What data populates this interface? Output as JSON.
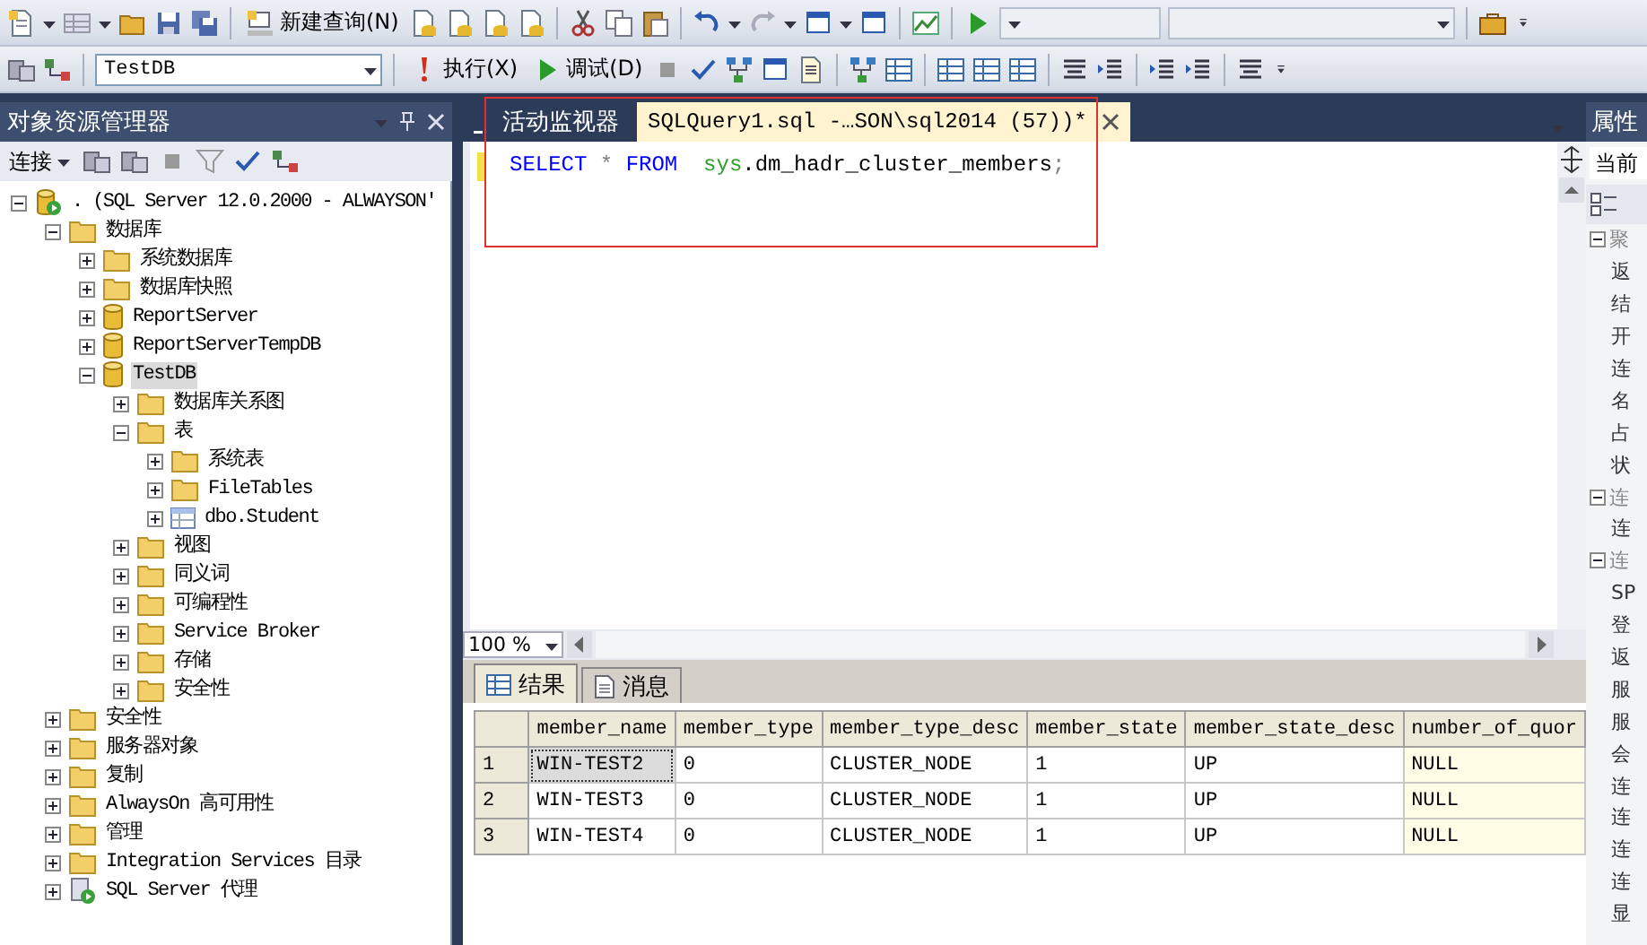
{
  "toolbar": {
    "new_query": "新建查询(N)",
    "database": "TestDB",
    "execute": "执行(X)",
    "debug": "调试(D)"
  },
  "object_explorer": {
    "title": "对象资源管理器",
    "connect": "连接",
    "tree": [
      {
        "label": ". (SQL Server 12.0.2000 - ALWAYSON'",
        "kind": "server",
        "expanded": true,
        "selected": false,
        "children": [
          {
            "label": "数据库",
            "kind": "folder",
            "expanded": true,
            "selected": false,
            "children": [
              {
                "label": "系统数据库",
                "kind": "folder",
                "expanded": false,
                "selected": false
              },
              {
                "label": "数据库快照",
                "kind": "folder",
                "expanded": false,
                "selected": false
              },
              {
                "label": "ReportServer",
                "kind": "database",
                "expanded": false,
                "selected": false
              },
              {
                "label": "ReportServerTempDB",
                "kind": "database",
                "expanded": false,
                "selected": false
              },
              {
                "label": "TestDB",
                "kind": "database",
                "expanded": true,
                "selected": true,
                "children": [
                  {
                    "label": "数据库关系图",
                    "kind": "folder",
                    "expanded": false,
                    "selected": false
                  },
                  {
                    "label": "表",
                    "kind": "folder",
                    "expanded": true,
                    "selected": false,
                    "children": [
                      {
                        "label": "系统表",
                        "kind": "folder",
                        "expanded": false,
                        "selected": false
                      },
                      {
                        "label": "FileTables",
                        "kind": "folder",
                        "expanded": false,
                        "selected": false
                      },
                      {
                        "label": "dbo.Student",
                        "kind": "table",
                        "expanded": false,
                        "selected": false
                      }
                    ]
                  },
                  {
                    "label": "视图",
                    "kind": "folder",
                    "expanded": false,
                    "selected": false
                  },
                  {
                    "label": "同义词",
                    "kind": "folder",
                    "expanded": false,
                    "selected": false
                  },
                  {
                    "label": "可编程性",
                    "kind": "folder",
                    "expanded": false,
                    "selected": false
                  },
                  {
                    "label": "Service Broker",
                    "kind": "folder",
                    "expanded": false,
                    "selected": false
                  },
                  {
                    "label": "存储",
                    "kind": "folder",
                    "expanded": false,
                    "selected": false
                  },
                  {
                    "label": "安全性",
                    "kind": "folder",
                    "expanded": false,
                    "selected": false
                  }
                ]
              }
            ]
          },
          {
            "label": "安全性",
            "kind": "folder",
            "expanded": false,
            "selected": false
          },
          {
            "label": "服务器对象",
            "kind": "folder",
            "expanded": false,
            "selected": false
          },
          {
            "label": "复制",
            "kind": "folder",
            "expanded": false,
            "selected": false
          },
          {
            "label": "AlwaysOn 高可用性",
            "kind": "folder",
            "expanded": false,
            "selected": false
          },
          {
            "label": "管理",
            "kind": "folder",
            "expanded": false,
            "selected": false
          },
          {
            "label": "Integration Services 目录",
            "kind": "folder",
            "expanded": false,
            "selected": false
          },
          {
            "label": "SQL Server 代理",
            "kind": "agent",
            "expanded": false,
            "selected": false
          }
        ]
      }
    ]
  },
  "document_tabs": [
    {
      "label": "活动监视器",
      "selected": false
    },
    {
      "label": "SQLQuery1.sql -…SON\\sql2014 (57))*",
      "selected": true
    }
  ],
  "editor": {
    "tokens": [
      {
        "text": "SELECT",
        "kind": "keyword"
      },
      {
        "text": "*",
        "kind": "operator"
      },
      {
        "text": "FROM",
        "kind": "keyword"
      },
      {
        "text": "sys",
        "kind": "system"
      },
      {
        "text": ".dm_hadr_cluster_members",
        "kind": "plain"
      },
      {
        "text": ";",
        "kind": "operator"
      }
    ],
    "zoom": "100 %"
  },
  "result_tabs": [
    {
      "label": "结果",
      "selected": true
    },
    {
      "label": "消息",
      "selected": false
    }
  ],
  "results": {
    "columns": [
      "member_name",
      "member_type",
      "member_type_desc",
      "member_state",
      "member_state_desc",
      "number_of_quor"
    ],
    "rows": [
      {
        "number": "1",
        "cells": [
          "WIN-TEST2",
          "0",
          "CLUSTER_NODE",
          "1",
          "UP",
          "NULL"
        ],
        "selected": true
      },
      {
        "number": "2",
        "cells": [
          "WIN-TEST3",
          "0",
          "CLUSTER_NODE",
          "1",
          "UP",
          "NULL"
        ],
        "selected": false
      },
      {
        "number": "3",
        "cells": [
          "WIN-TEST4",
          "0",
          "CLUSTER_NODE",
          "1",
          "UP",
          "NULL"
        ],
        "selected": false
      }
    ]
  },
  "properties": {
    "title": "属性",
    "object": "当前",
    "items": [
      {
        "kind": "group",
        "text": "聚"
      },
      {
        "kind": "row",
        "text": "返"
      },
      {
        "kind": "row",
        "text": "结"
      },
      {
        "kind": "row",
        "text": "开"
      },
      {
        "kind": "row",
        "text": "连"
      },
      {
        "kind": "row",
        "text": "名"
      },
      {
        "kind": "row",
        "text": "占"
      },
      {
        "kind": "row",
        "text": "状"
      },
      {
        "kind": "group",
        "text": "连"
      },
      {
        "kind": "row",
        "text": "连"
      },
      {
        "kind": "group",
        "text": "连"
      },
      {
        "kind": "row",
        "text": "SP"
      },
      {
        "kind": "row",
        "text": "登"
      },
      {
        "kind": "row",
        "text": "返"
      },
      {
        "kind": "row",
        "text": "服"
      },
      {
        "kind": "row",
        "text": "服"
      },
      {
        "kind": "row",
        "text": "会"
      },
      {
        "kind": "row",
        "text": "连"
      },
      {
        "kind": "row",
        "text": "连"
      },
      {
        "kind": "row",
        "text": "连"
      },
      {
        "kind": "row",
        "text": "连"
      },
      {
        "kind": "row",
        "text": "显"
      }
    ]
  }
}
